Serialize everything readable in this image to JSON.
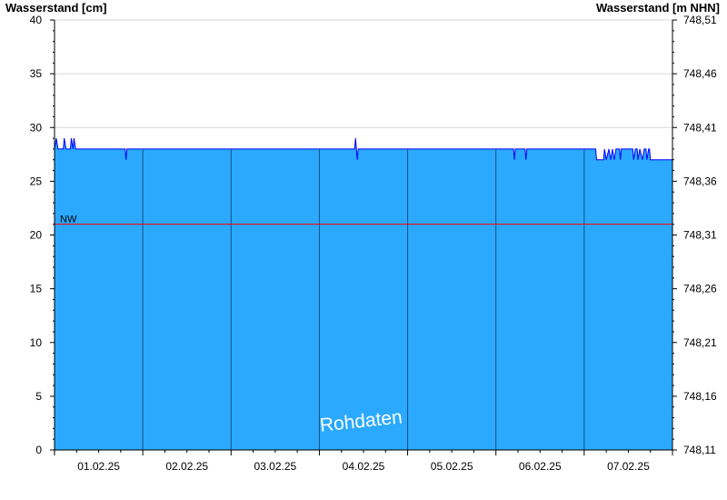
{
  "chart_data": {
    "type": "area",
    "ylabel_left": "Wasserstand [cm]",
    "ylabel_right": "Wasserstand [m NHN]",
    "ylim": [
      0,
      40
    ],
    "yticks_left": [
      0,
      5,
      10,
      15,
      20,
      25,
      30,
      35,
      40
    ],
    "yticks_right": [
      "748,11",
      "748,16",
      "748,21",
      "748,26",
      "748,31",
      "748,36",
      "748,41",
      "748,46",
      "748,51"
    ],
    "xlim": [
      0,
      7
    ],
    "x_tick_labels": [
      "01.02.25",
      "02.02.25",
      "03.02.25",
      "04.02.25",
      "05.02.25",
      "06.02.25",
      "07.02.25"
    ],
    "day_boundaries": [
      1,
      2,
      3,
      4,
      5,
      6
    ],
    "series": [
      {
        "values": [
          [
            0.0,
            28
          ],
          [
            0.02,
            29
          ],
          [
            0.04,
            28
          ],
          [
            0.1,
            28
          ],
          [
            0.11,
            29
          ],
          [
            0.13,
            28
          ],
          [
            0.18,
            28
          ],
          [
            0.19,
            29
          ],
          [
            0.21,
            28
          ],
          [
            0.22,
            29
          ],
          [
            0.24,
            28
          ],
          [
            0.8,
            28
          ],
          [
            0.81,
            27
          ],
          [
            0.82,
            28
          ],
          [
            3.4,
            28
          ],
          [
            3.41,
            29
          ],
          [
            3.42,
            28
          ],
          [
            3.43,
            27
          ],
          [
            3.44,
            28
          ],
          [
            5.2,
            28
          ],
          [
            5.21,
            27
          ],
          [
            5.22,
            28
          ],
          [
            5.33,
            28
          ],
          [
            5.34,
            27
          ],
          [
            5.35,
            28
          ],
          [
            6.13,
            28
          ],
          [
            6.14,
            27
          ],
          [
            6.22,
            27
          ],
          [
            6.23,
            28
          ],
          [
            6.25,
            27
          ],
          [
            6.28,
            28
          ],
          [
            6.3,
            27
          ],
          [
            6.32,
            28
          ],
          [
            6.34,
            27
          ],
          [
            6.36,
            28
          ],
          [
            6.4,
            28
          ],
          [
            6.41,
            27
          ],
          [
            6.42,
            28
          ],
          [
            6.55,
            28
          ],
          [
            6.56,
            27
          ],
          [
            6.58,
            28
          ],
          [
            6.6,
            28
          ],
          [
            6.61,
            27
          ],
          [
            6.63,
            28
          ],
          [
            6.66,
            27
          ],
          [
            6.68,
            28
          ],
          [
            6.7,
            28
          ],
          [
            6.71,
            27
          ],
          [
            6.73,
            28
          ],
          [
            6.74,
            28
          ],
          [
            6.75,
            27
          ],
          [
            7.0,
            27
          ]
        ],
        "fill_color": "#2aa9ff",
        "line_color": "#0000ff"
      }
    ],
    "threshold": {
      "label": "NW",
      "value": 21,
      "color": "#ff0000"
    },
    "watermark": "Rohdaten",
    "grid": true
  }
}
